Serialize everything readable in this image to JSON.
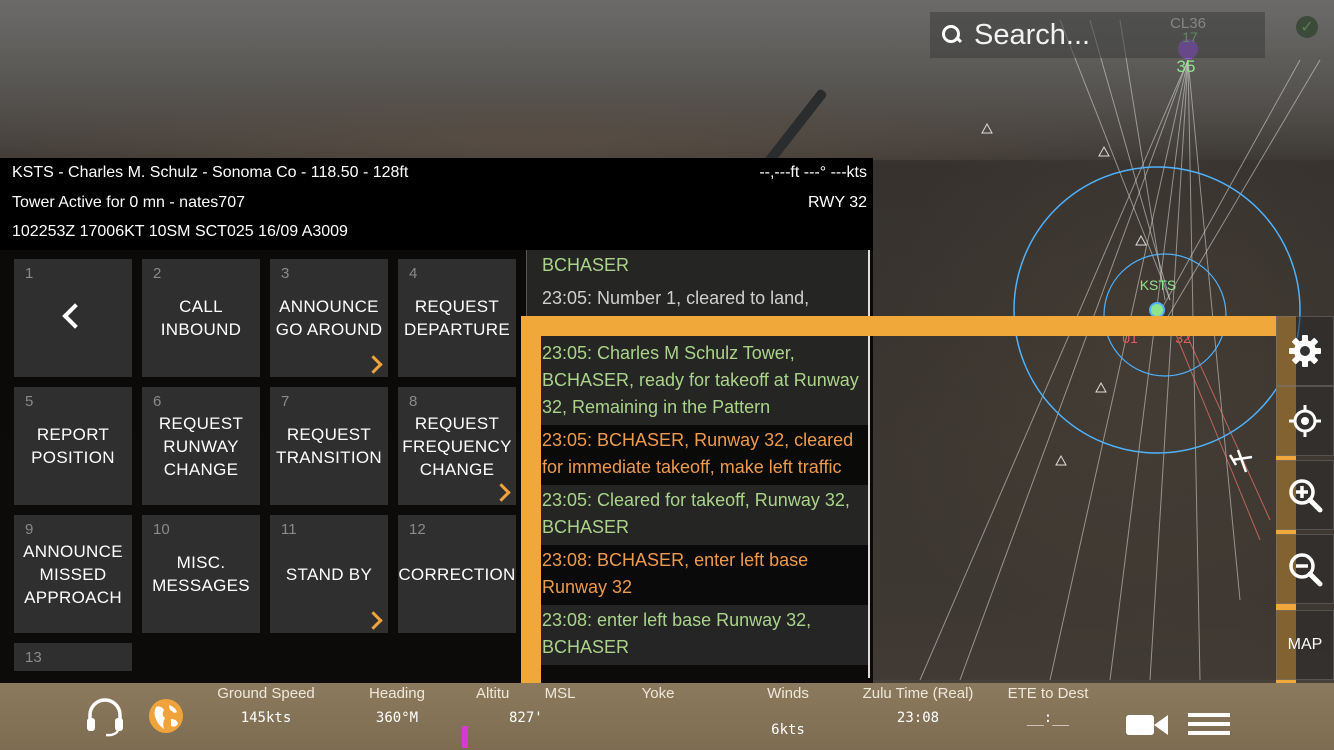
{
  "search": {
    "placeholder": "Search..."
  },
  "map": {
    "top_airport": {
      "name": "CL36",
      "runway_a": "17",
      "runway_b": "35"
    },
    "center_airport": {
      "name": "KSTS",
      "runway_left": "01",
      "runway_right": "32"
    }
  },
  "atc_panel": {
    "header": {
      "line1": "KSTS - Charles M. Schulz - Sonoma Co - 118.50 - 128ft",
      "line2": "Tower Active for 0 mn - nates707",
      "line3": "102253Z 17006KT 10SM SCT025 16/09 A3009",
      "right1": "--,---ft  ---° ---kts",
      "right2": "RWY 32"
    },
    "buttons": [
      {
        "num": "1",
        "label": "",
        "has_submenu": false,
        "back": true
      },
      {
        "num": "2",
        "label": "CALL\nINBOUND",
        "has_submenu": false
      },
      {
        "num": "3",
        "label": "ANNOUNCE\nGO AROUND",
        "has_submenu": true
      },
      {
        "num": "4",
        "label": "REQUEST\nDEPARTURE",
        "has_submenu": false
      },
      {
        "num": "5",
        "label": "REPORT\nPOSITION",
        "has_submenu": false
      },
      {
        "num": "6",
        "label": "REQUEST\nRUNWAY\nCHANGE",
        "has_submenu": false
      },
      {
        "num": "7",
        "label": "REQUEST\nTRANSITION",
        "has_submenu": false
      },
      {
        "num": "8",
        "label": "REQUEST\nFREQUENCY\nCHANGE",
        "has_submenu": true
      },
      {
        "num": "9",
        "label": "ANNOUNCE\nMISSED\nAPPROACH",
        "has_submenu": false
      },
      {
        "num": "10",
        "label": "MISC.\nMESSAGES",
        "has_submenu": false
      },
      {
        "num": "11",
        "label": "STAND BY",
        "has_submenu": true
      },
      {
        "num": "12",
        "label": "CORRECTION",
        "has_submenu": false
      },
      {
        "num": "13",
        "label": "",
        "has_submenu": false
      }
    ],
    "messages": [
      {
        "text": "BCHASER",
        "color": "green",
        "style": "alt"
      },
      {
        "text": "23:05: Number 1, cleared to land,",
        "color": "gray",
        "style": "alt"
      },
      {
        "text": "",
        "color": "gray",
        "style": "alt"
      },
      {
        "text": "23:05: Charles M Schulz Tower, BCHASER, ready for takeoff at Runway 32, Remaining in the Pattern",
        "color": "green",
        "style": "alt"
      },
      {
        "text": "23:05: BCHASER, Runway 32, cleared for immediate takeoff, make left traffic",
        "color": "orange",
        "style": "dark"
      },
      {
        "text": "23:05: Cleared for takeoff, Runway 32, BCHASER",
        "color": "green",
        "style": "alt"
      },
      {
        "text": "23:08: BCHASER, enter left base Runway 32",
        "color": "orange",
        "style": "dark"
      },
      {
        "text": "23:08: enter left base Runway 32, BCHASER",
        "color": "green",
        "style": "alt"
      }
    ]
  },
  "side_buttons": {
    "map_label": "MAP"
  },
  "instruments": [
    {
      "label": "Ground Speed",
      "value": "145kts"
    },
    {
      "label": "Heading",
      "value": "360°M"
    },
    {
      "label": "Altitu",
      "value": "827'"
    },
    {
      "label": "MSL",
      "value": ""
    },
    {
      "label": "Yoke",
      "value": ""
    },
    {
      "label": "Winds",
      "value": "6kts"
    },
    {
      "label": "Zulu Time (Real)",
      "value": "23:08"
    },
    {
      "label": "ETE to Dest",
      "value": "__:__"
    }
  ],
  "colors": {
    "highlight": "#f0a83a",
    "accent": "#f0a33c",
    "msg_green": "#a9d48a",
    "msg_orange": "#ec9a4e"
  }
}
